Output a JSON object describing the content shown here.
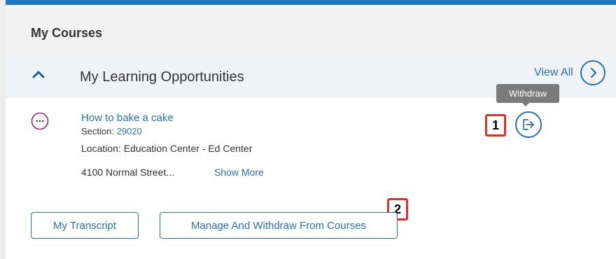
{
  "section": {
    "title": "My Courses"
  },
  "subsection": {
    "title": "My Learning Opportunities",
    "view_all_label": "View All"
  },
  "tooltip": {
    "text": "Withdraw"
  },
  "course": {
    "title": "How to bake a cake",
    "section_label": "Section:",
    "section_value": "29020",
    "location": "Location: Education Center - Ed Center",
    "address": "4100 Normal Street...",
    "show_more": "Show More"
  },
  "callouts": {
    "one": "1",
    "two": "2"
  },
  "buttons": {
    "transcript": "My Transcript",
    "manage": "Manage And Withdraw From Courses"
  },
  "colors": {
    "accent": "#1a77c2",
    "link": "#2a6fb3",
    "callout": "#e0302e",
    "header_bg": "#f2f2f2",
    "subheader_bg": "#f0f3f6"
  },
  "icons": [
    "chevron-up-icon",
    "chevron-right-icon",
    "more-options-icon",
    "withdraw-exit-icon"
  ]
}
